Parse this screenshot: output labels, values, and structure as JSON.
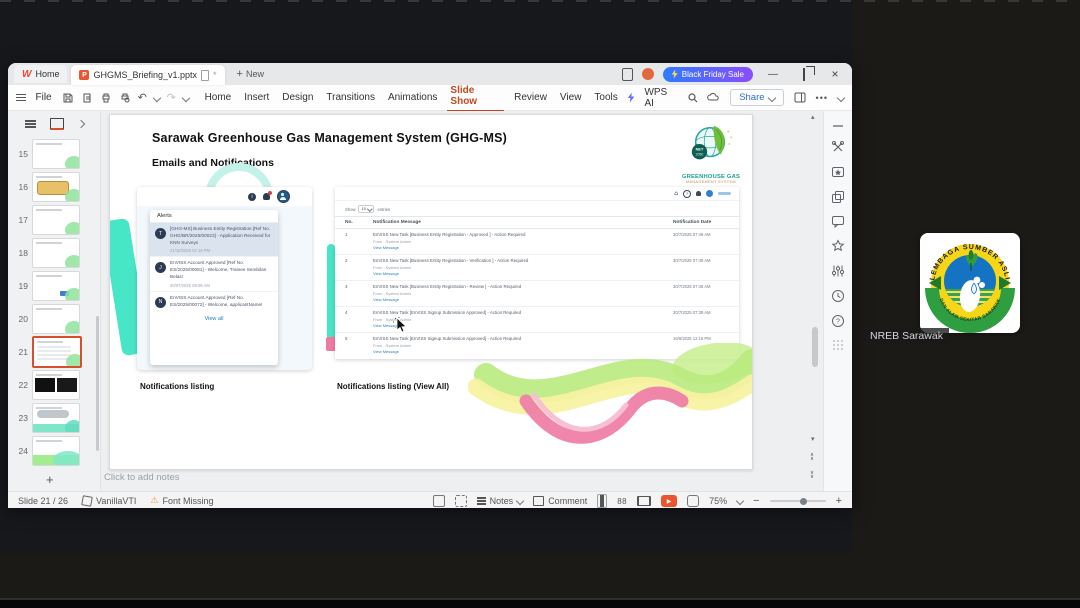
{
  "titlebar": {
    "home_tab": "Home",
    "doc_tab": "GHGMS_Briefing_v1.pptx",
    "new_tab": "New",
    "promo": "Black Friday Sale"
  },
  "menubar": {
    "file": "File",
    "items": [
      "Home",
      "Insert",
      "Design",
      "Transitions",
      "Animations",
      "Slide Show",
      "Review",
      "View",
      "Tools",
      "WPS AI"
    ],
    "share": "Share"
  },
  "thumbs": {
    "items": [
      {
        "num": "15"
      },
      {
        "num": "16"
      },
      {
        "num": "17"
      },
      {
        "num": "18"
      },
      {
        "num": "19"
      },
      {
        "num": "20"
      },
      {
        "num": "21"
      },
      {
        "num": "22"
      },
      {
        "num": "23"
      },
      {
        "num": "24"
      }
    ],
    "selected": "21"
  },
  "slide": {
    "title": "Sarawak Greenhouse Gas Management System (GHG-MS)",
    "subtitle": "Emails and Notifications",
    "logo": {
      "line1": "GREENHOUSE GAS",
      "line2": "MANAGEMENT SYSTEM",
      "badge1": "NET",
      "badge2": "2050"
    },
    "caption_left": "Notifications listing",
    "caption_right": "Notifications listing (View All)",
    "alerts": {
      "header": "Alerts",
      "view_all": "View all",
      "items": [
        {
          "initial": "T",
          "text": "[GHG-MS] Business Entity Registration [Ref No. GHG/BR/2025/00023] - Application Received for KNN Surveys",
          "time": "21/10/2025 02:19 PM"
        },
        {
          "initial": "J",
          "text": "EnVISS Account Approved [Ref No. ES/2025/00081] - Welcome, Trainee Sembilan Belas!",
          "time": "30/07/2025 09:09 AM"
        },
        {
          "initial": "N",
          "text": "EnVISS Account Approved [Ref No. ES/2025/00072] - Welcome, applicantName!",
          "time": ""
        }
      ]
    },
    "table": {
      "show_label": "Show",
      "show_value": "10",
      "entries_label": "entries",
      "col_no": "No.",
      "col_message": "Notification Message",
      "col_date": "Notification Date",
      "from_label": "From : System Admin",
      "link_label": "View Message",
      "rows": [
        {
          "no": "1",
          "message": "EnVISS New Task [Business Entity Registration - Approved ] - Action Required",
          "date": "30/7/2025 07:49 AM"
        },
        {
          "no": "2",
          "message": "EnVISS New Task [Business Entity Registration - Verification ] - Action Required",
          "date": "30/7/2025 07:49 AM"
        },
        {
          "no": "3",
          "message": "EnVISS New Task [Business Entity Registration - Review ] - Action Required",
          "date": "30/7/2025 07:46 AM"
        },
        {
          "no": "4",
          "message": "EnVISS New Task [EnVISS Signup Submission Approved] - Action Required",
          "date": "30/7/2025 07:39 AM"
        },
        {
          "no": "5",
          "message": "EnVISS New Task [EnVISS Signup Submission Approved] - Action Required",
          "date": "16/6/2025 12:16 PM"
        }
      ]
    }
  },
  "notes_placeholder": "Click to add notes",
  "statusbar": {
    "slide_indicator": "Slide 21 / 26",
    "theme": "VanillaVTI",
    "warning": "Font Missing",
    "notes_label": "Notes",
    "comment_label": "Comment",
    "zoom_percent": "75%"
  },
  "meeting": {
    "participant_name": "NREB Sarawak",
    "logo_top_text": "LEMBAGA SUMBER ASLI",
    "logo_bottom_text": "DAN ALAM SEKITAR SARAWAK"
  },
  "colors": {
    "accent_orange": "#d8502b",
    "promo_start": "#2e7bff",
    "promo_end": "#8a4dff",
    "teal_decor": "#47e6c6",
    "link_blue": "#2f80c7"
  }
}
